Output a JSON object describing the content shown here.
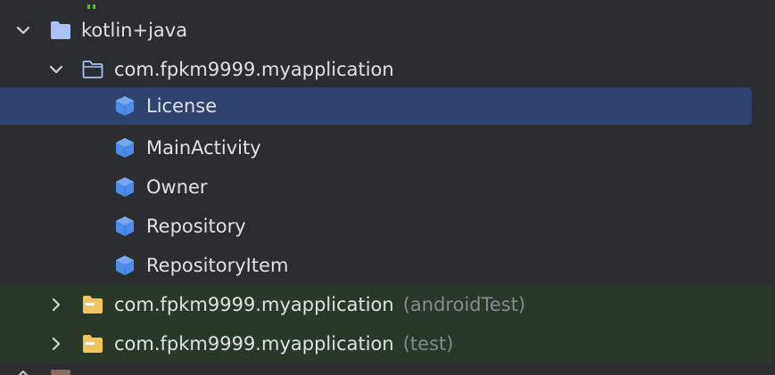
{
  "tree": {
    "nodes": [
      {
        "label": "kotlin+java",
        "icon": "folder-icon",
        "expanded": true
      },
      {
        "label": "com.fpkm9999.myapplication",
        "icon": "package-outline-icon",
        "expanded": true
      },
      {
        "label": "License",
        "icon": "class-icon",
        "selected": true
      },
      {
        "label": "MainActivity",
        "icon": "class-icon"
      },
      {
        "label": "Owner",
        "icon": "class-icon"
      },
      {
        "label": "Repository",
        "icon": "class-icon"
      },
      {
        "label": "RepositoryItem",
        "icon": "class-icon"
      },
      {
        "label": "com.fpkm9999.myapplication",
        "suffix": "(androidTest)",
        "icon": "test-package-icon",
        "expanded": false
      },
      {
        "label": "com.fpkm9999.myapplication",
        "suffix": "(test)",
        "icon": "test-package-icon",
        "expanded": false
      }
    ]
  },
  "colors": {
    "background": "#2b2d30",
    "selection": "#2e436e",
    "test_background": "#293829",
    "text": "#dfe1e5",
    "muted_text": "#868a91",
    "folder_blue": "#a9c1f5",
    "class_blue": "#4e8ae8",
    "test_folder_yellow": "#f2c55c"
  }
}
